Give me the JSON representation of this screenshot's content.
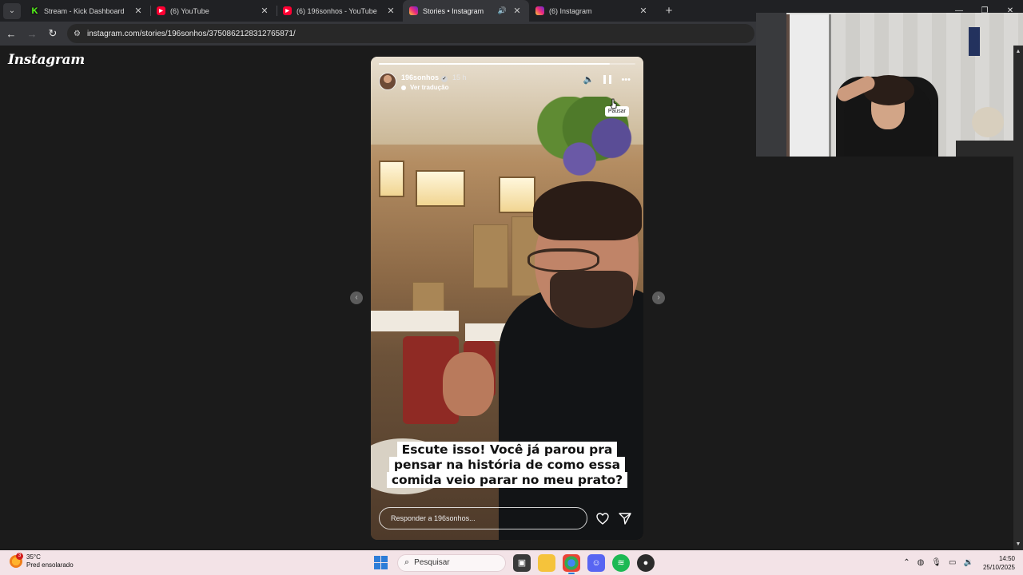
{
  "browser": {
    "tabs": [
      {
        "title": "Stream - Kick Dashboard",
        "favicon": "kick-icon"
      },
      {
        "title": "(6) YouTube",
        "favicon": "youtube-icon"
      },
      {
        "title": "(6) 196sonhos - YouTube",
        "favicon": "youtube-icon"
      },
      {
        "title": "Stories • Instagram",
        "favicon": "instagram-icon",
        "active": true,
        "muted_audio": true
      },
      {
        "title": "(6) Instagram",
        "favicon": "instagram-icon"
      }
    ],
    "url": "instagram.com/stories/196sonhos/3750862128312765871/"
  },
  "instagram": {
    "logo": "Instagram",
    "story": {
      "username": "196sonhos",
      "time_ago": "15 h",
      "translate_label": "Ver tradução",
      "tooltip": "Pausar",
      "progress": 0.9,
      "caption_lines": [
        "Escute isso! Você já parou pra",
        "pensar na história de como essa",
        "comida veio parar no meu prato?"
      ],
      "reply_placeholder": "Responder a 196sonhos..."
    }
  },
  "taskbar": {
    "weather_temp": "35°C",
    "weather_desc": "Pred ensolarado",
    "weather_badge": "3",
    "search_placeholder": "Pesquisar",
    "time": "14:50",
    "date": "25/10/2025"
  },
  "colors": {
    "accent": "#2d7dd8",
    "browser_dark": "#202124",
    "page_bg": "#1b1b1b",
    "taskbar": "#f3e3e7"
  }
}
